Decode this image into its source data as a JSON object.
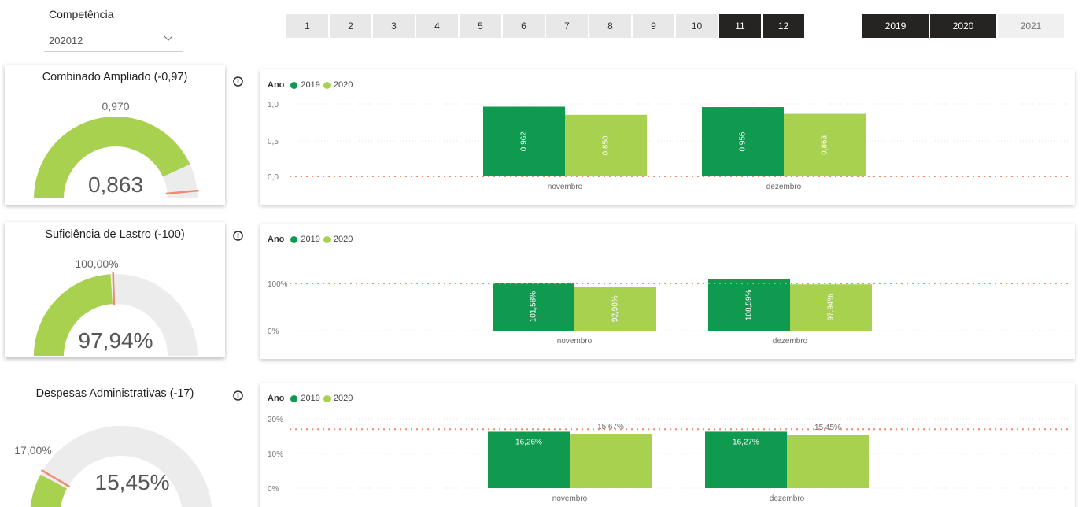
{
  "slicer": {
    "title": "Competência",
    "value": "202012"
  },
  "months": [
    {
      "label": "1",
      "selected": false
    },
    {
      "label": "2",
      "selected": false
    },
    {
      "label": "3",
      "selected": false
    },
    {
      "label": "4",
      "selected": false
    },
    {
      "label": "5",
      "selected": false
    },
    {
      "label": "6",
      "selected": false
    },
    {
      "label": "7",
      "selected": false
    },
    {
      "label": "8",
      "selected": false
    },
    {
      "label": "9",
      "selected": false
    },
    {
      "label": "10",
      "selected": false
    },
    {
      "label": "11",
      "selected": true
    },
    {
      "label": "12",
      "selected": true
    }
  ],
  "years": [
    {
      "label": "2019",
      "selected": true
    },
    {
      "label": "2020",
      "selected": true
    },
    {
      "label": "2021",
      "selected": false
    }
  ],
  "colors": {
    "c2019": "#0f9a50",
    "c2020": "#a8d14f",
    "target": "#f08a70",
    "track": "#ececec",
    "dark": "#252423"
  },
  "icons": {
    "info": "info-icon",
    "dropdown": "chevron-down-icon"
  },
  "kpis": [
    {
      "title": "Combinado Ampliado (-0,97)",
      "target_label": "0,970",
      "value_label": "0,863",
      "fill_fraction": 0.863,
      "target_fraction": 0.97
    },
    {
      "title": "Suficiência de Lastro (-100)",
      "target_label": "100,00%",
      "value_label": "97,94%",
      "fill_fraction": 0.48,
      "target_fraction": 0.49
    },
    {
      "title": "Despesas Administrativas (-17)",
      "target_label": "17,00%",
      "value_label": "15,45%",
      "fill_fraction": 0.1545,
      "target_fraction": 0.17
    }
  ],
  "chart_data": [
    {
      "type": "bar",
      "legend_title": "Ano",
      "categories": [
        "novembro",
        "dezembro"
      ],
      "series": [
        {
          "name": "2019",
          "values": [
            0.962,
            0.956
          ],
          "labels": [
            "0,962",
            "0,956"
          ]
        },
        {
          "name": "2020",
          "values": [
            0.85,
            0.863
          ],
          "labels": [
            "0,850",
            "0,863"
          ]
        }
      ],
      "yticks": [
        "1,0",
        "0,5",
        "0,0"
      ],
      "ylim": [
        0,
        1.0
      ],
      "reference_line": 0.0,
      "label_orientation": "vertical"
    },
    {
      "type": "bar",
      "legend_title": "Ano",
      "categories": [
        "novembro",
        "dezembro"
      ],
      "series": [
        {
          "name": "2019",
          "values": [
            101.58,
            108.59
          ],
          "labels": [
            "101,58%",
            "108,59%"
          ]
        },
        {
          "name": "2020",
          "values": [
            92.9,
            97.94
          ],
          "labels": [
            "92,90%",
            "97,94%"
          ]
        }
      ],
      "yticks": [
        "100%",
        "0%"
      ],
      "ylim": [
        0,
        100
      ],
      "reference_line": 100,
      "label_orientation": "vertical"
    },
    {
      "type": "bar",
      "legend_title": "Ano",
      "categories": [
        "novembro",
        "dezembro"
      ],
      "series": [
        {
          "name": "2019",
          "values": [
            16.26,
            16.27
          ],
          "labels": [
            "16,26%",
            "16,27%"
          ]
        },
        {
          "name": "2020",
          "values": [
            15.67,
            15.45
          ],
          "labels": [
            "15,67%",
            "15,45%"
          ]
        }
      ],
      "yticks": [
        "20%",
        "10%",
        "0%"
      ],
      "ylim": [
        0,
        20
      ],
      "reference_line": 17,
      "label_orientation": "horizontal"
    }
  ]
}
